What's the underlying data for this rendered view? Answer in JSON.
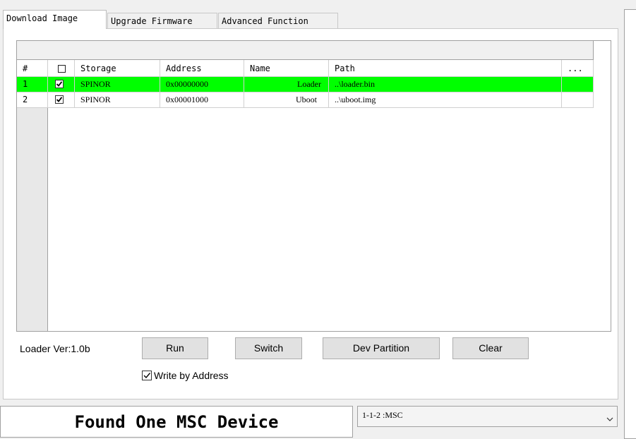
{
  "tabs": [
    "Download Image",
    "Upgrade Firmware",
    "Advanced Function"
  ],
  "grid": {
    "headers": [
      "#",
      "Storage",
      "Address",
      "Name",
      "Path",
      "..."
    ],
    "rows": [
      {
        "index": "1",
        "checked": true,
        "storage": "SPINOR",
        "address": "0x00000000",
        "name": "Loader",
        "path": "..\\loader.bin",
        "highlighted": true
      },
      {
        "index": "2",
        "checked": true,
        "storage": "SPINOR",
        "address": "0x00001000",
        "name": "Uboot",
        "path": "..\\uboot.img",
        "highlighted": false
      }
    ],
    "highlight_color": "#00ff00"
  },
  "loader_version": "Loader Ver:1.0b",
  "buttons": {
    "run": "Run",
    "switch": "Switch",
    "dev_partition": "Dev Partition",
    "clear": "Clear"
  },
  "write_by_address": {
    "label": "Write by Address",
    "checked": true
  },
  "status_text": "Found One MSC Device",
  "device_select": {
    "value": "1-1-2 :MSC"
  }
}
